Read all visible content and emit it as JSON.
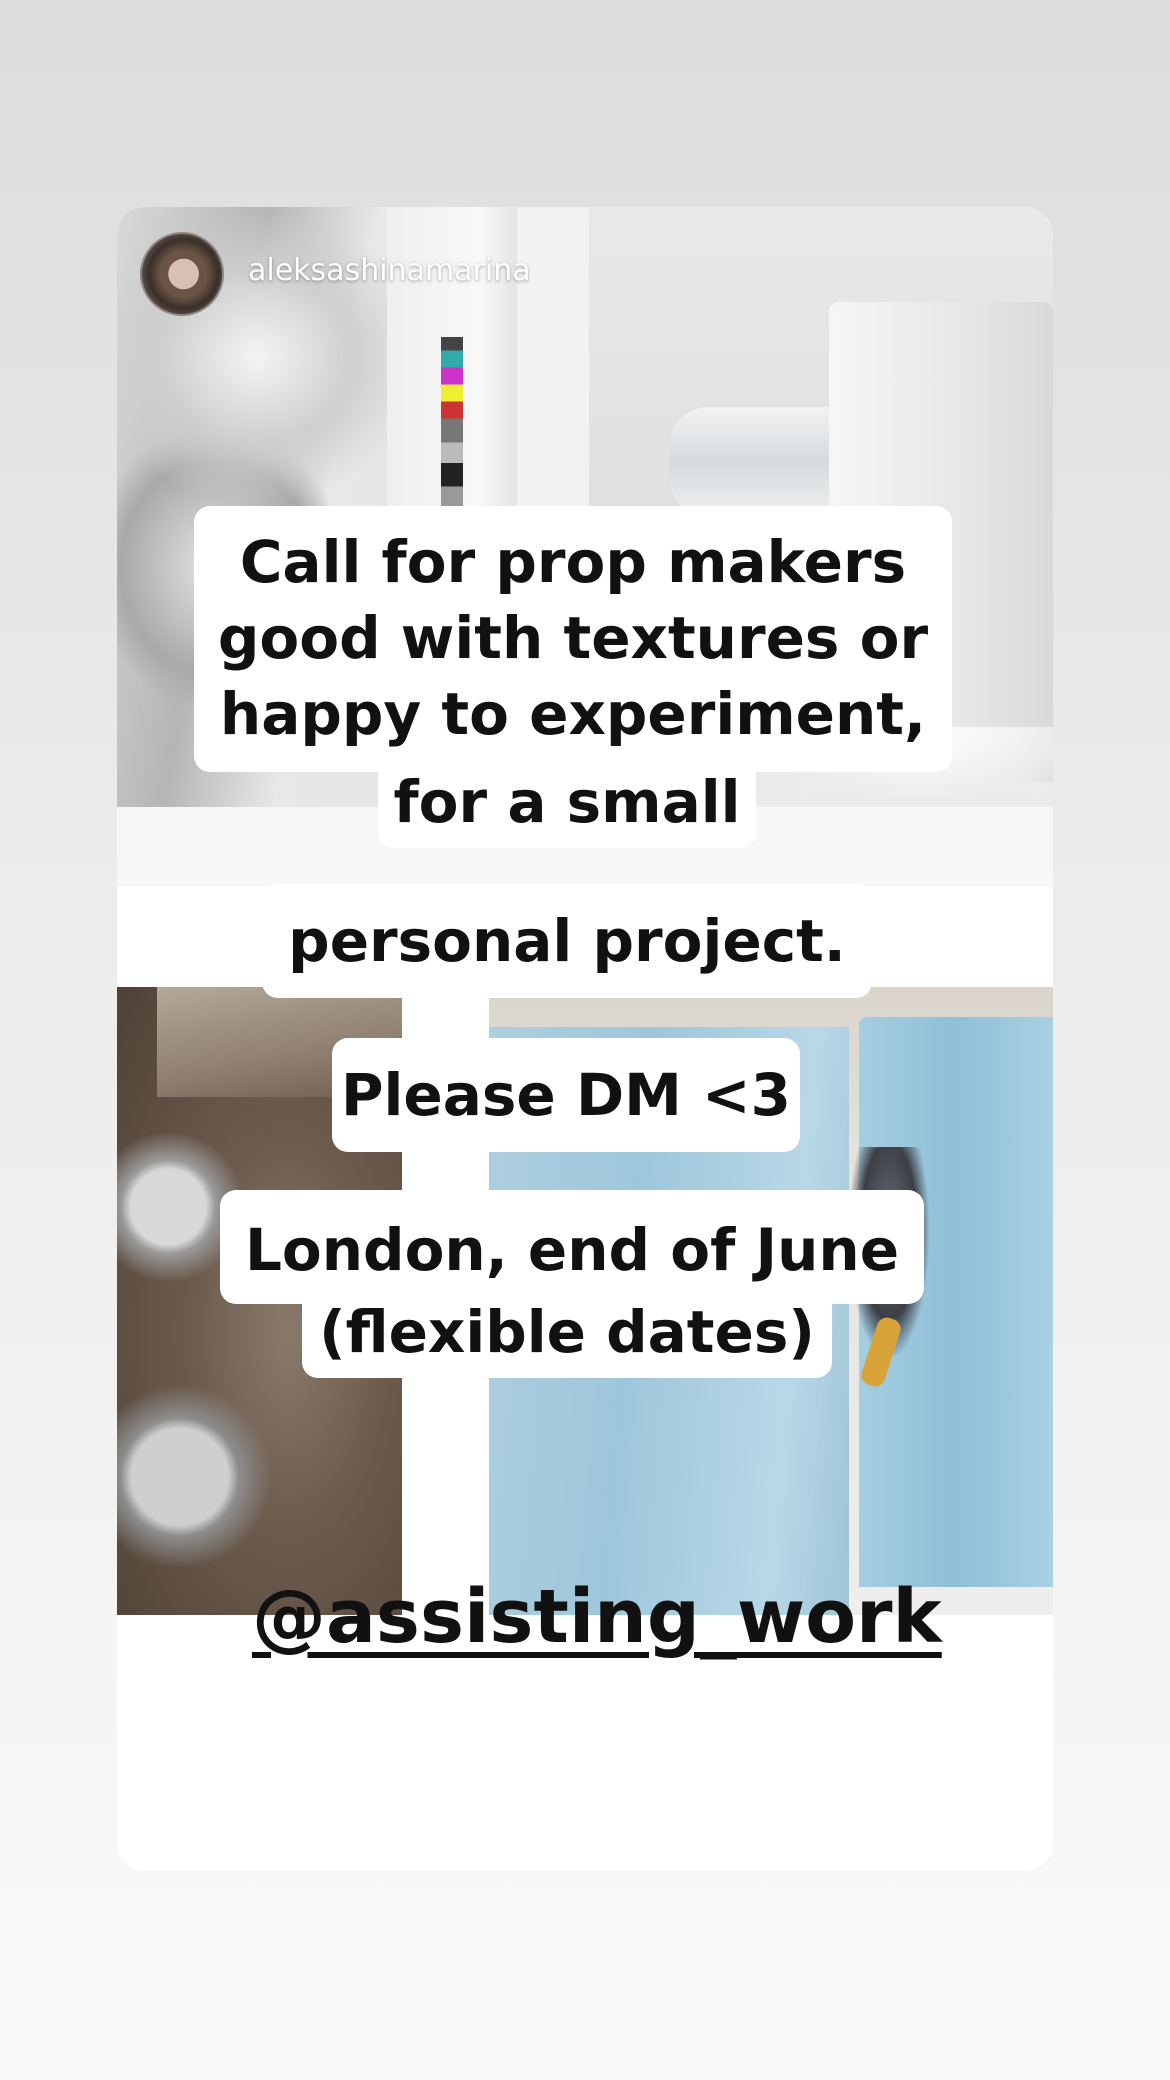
{
  "story": {
    "username": "aleksashinamarina",
    "stickers": {
      "line1": "Call for prop makers",
      "line2": "good with textures or",
      "line3": "happy to experiment,",
      "line4": "for a small",
      "line5": "personal project.",
      "line6": "Please DM <3",
      "line7": "London, end of June",
      "line8": "(flexible dates)"
    },
    "mention": "@assisting_work"
  }
}
